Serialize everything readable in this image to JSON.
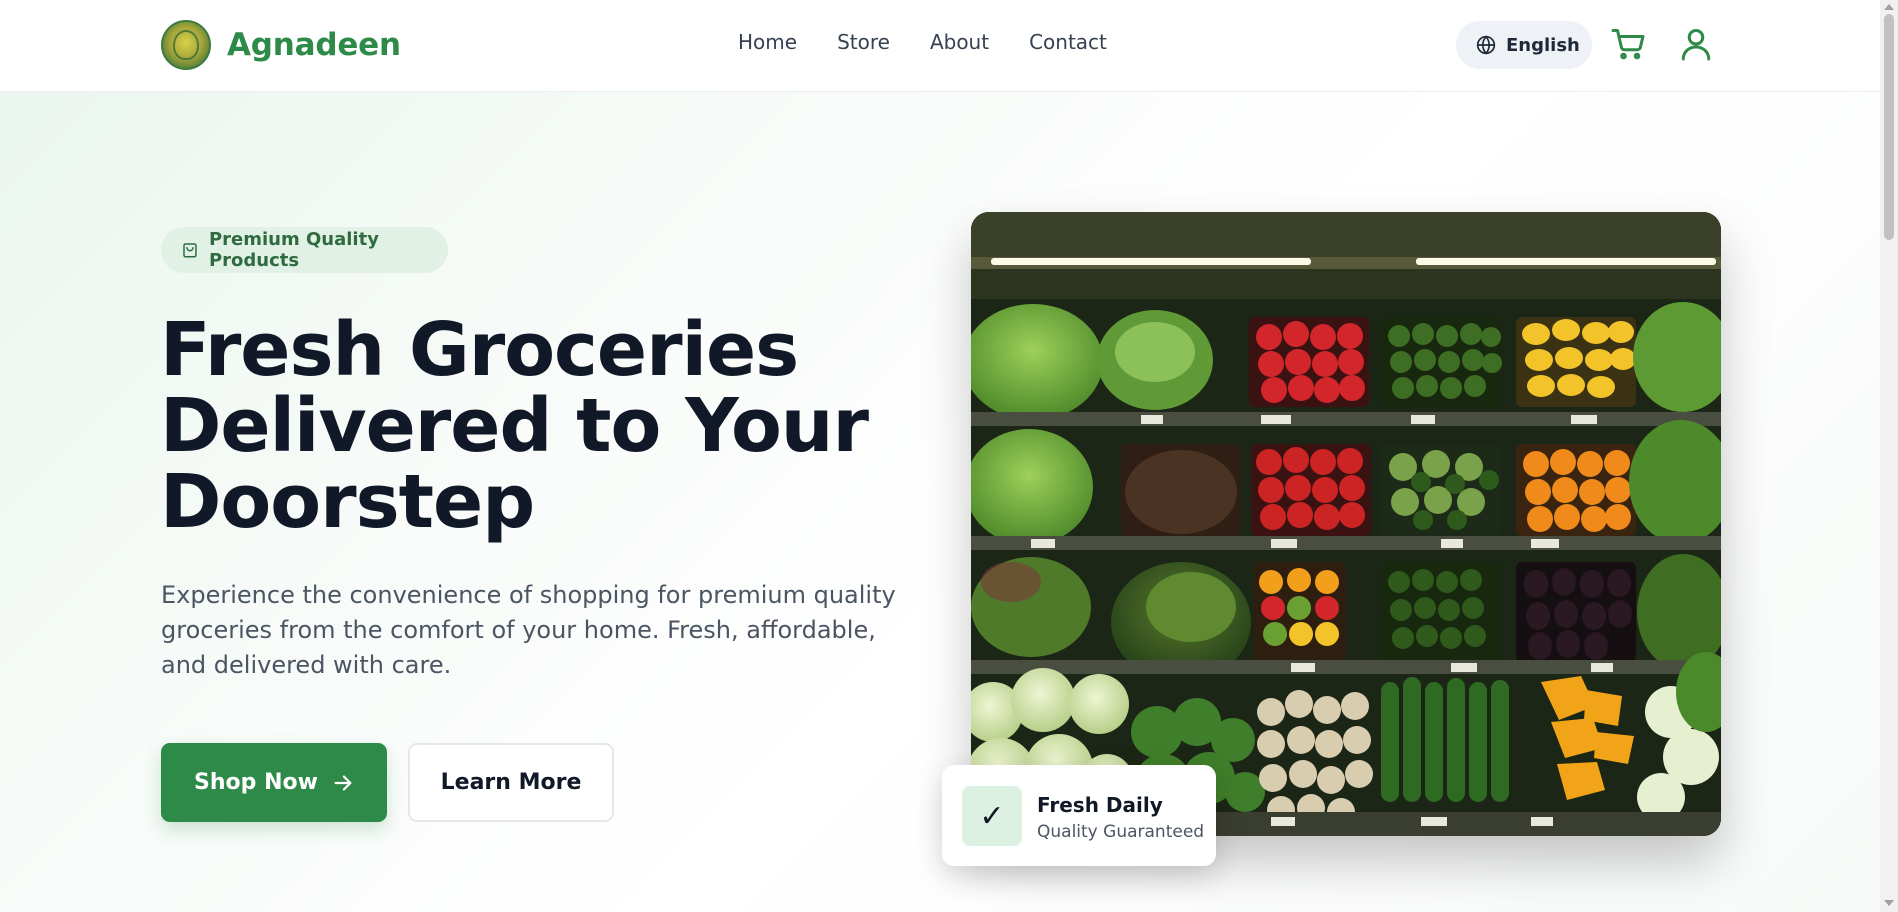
{
  "header": {
    "brand_name": "Agnadeen",
    "nav": [
      "Home",
      "Store",
      "About",
      "Contact"
    ],
    "language_label": "English",
    "icons": {
      "language": "globe-icon",
      "cart": "cart-icon",
      "account": "user-icon"
    }
  },
  "hero": {
    "badge_label": "Premium Quality Products",
    "title_lines": [
      "Fresh Groceries",
      "Delivered to Your",
      "Doorstep"
    ],
    "subtitle_lines": [
      "Experience the convenience of shopping for premium quality",
      "groceries from the comfort of your home. Fresh, affordable,",
      "and delivered with care."
    ],
    "primary_button": "Shop Now",
    "secondary_button": "Learn More",
    "feature_card": {
      "icon": "✓",
      "title": "Fresh Daily",
      "subtitle": "Quality Guaranteed"
    }
  },
  "colors": {
    "brand_green": "#2e8a48",
    "title_text": "#111827",
    "body_text": "#4b5563",
    "badge_bg": "#e2f1e6"
  }
}
